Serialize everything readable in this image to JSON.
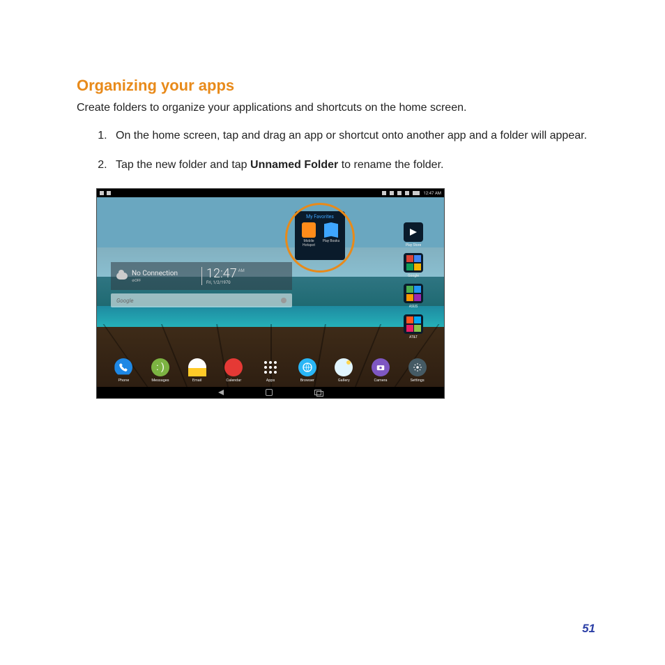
{
  "heading": "Organizing your apps",
  "intro": "Create folders to organize your applications and shortcuts on the home screen.",
  "steps": {
    "s1": "On the home screen, tap and drag an app or shortcut onto another app and a folder will appear.",
    "s2a": "Tap the new folder and tap ",
    "s2b": "Unnamed Folder",
    "s2c": " to rename the folder."
  },
  "page_number": "51",
  "screenshot": {
    "statusbar_time": "12:47 AM",
    "widget": {
      "connection": "No Connection",
      "off_label": "⊘OFF",
      "time": "12:47",
      "ampm": "AM",
      "date": "Fri, 1/2/1970"
    },
    "search_placeholder": "Google",
    "folder": {
      "title": "My Favorites",
      "apps": [
        {
          "label": "Mobile Hotspot"
        },
        {
          "label": "Play Books"
        }
      ]
    },
    "right_column": [
      {
        "label": "Play Store"
      },
      {
        "label": "Google"
      },
      {
        "label": "ASUS"
      },
      {
        "label": "AT&T"
      }
    ],
    "dock": [
      {
        "label": "Phone"
      },
      {
        "label": "Messages"
      },
      {
        "label": "Email"
      },
      {
        "label": "Calendar"
      },
      {
        "label": "Apps"
      },
      {
        "label": "Browser"
      },
      {
        "label": "Gallery"
      },
      {
        "label": "Camera"
      },
      {
        "label": "Settings"
      }
    ]
  }
}
